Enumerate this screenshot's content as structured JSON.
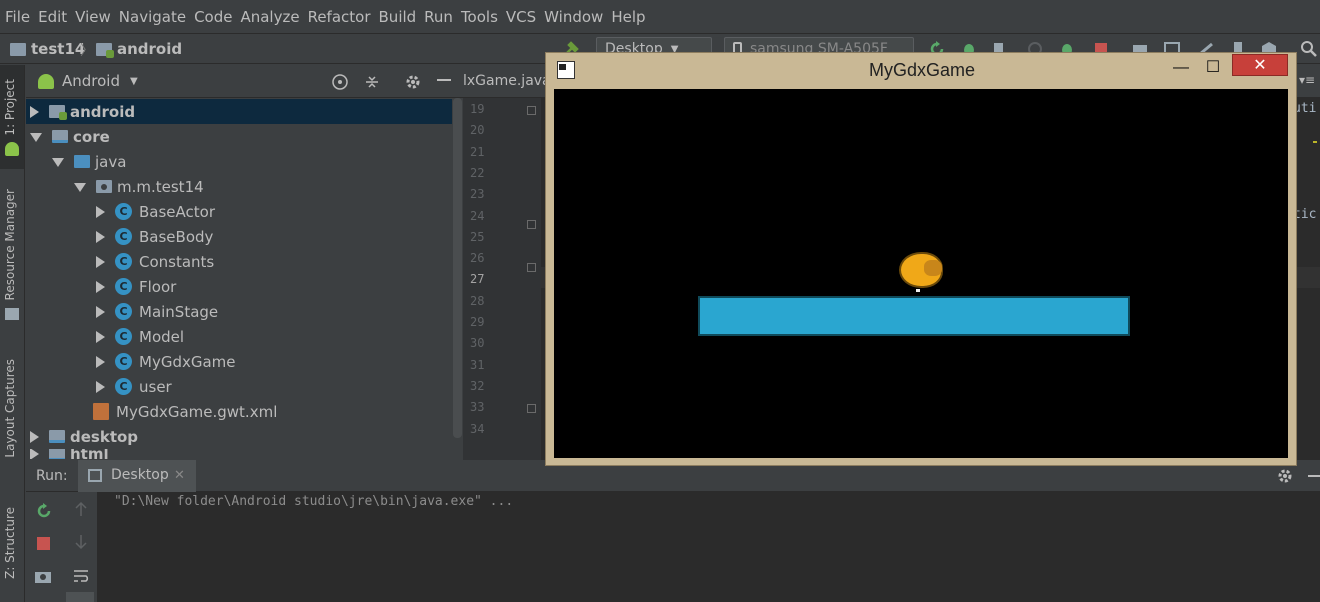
{
  "menu": [
    "File",
    "Edit",
    "View",
    "Navigate",
    "Code",
    "Analyze",
    "Refactor",
    "Build",
    "Run",
    "Tools",
    "VCS",
    "Window",
    "Help"
  ],
  "breadcrumb": {
    "project": "test14",
    "module": "android"
  },
  "toolbar": {
    "run_config": "Desktop",
    "device": "samsung SM-A505F"
  },
  "side_tabs": {
    "project": "1: Project",
    "resource_manager": "Resource Manager",
    "layout_captures": "Layout Captures",
    "structure": "Z: Structure"
  },
  "project_panel": {
    "view_mode": "Android",
    "tree": [
      {
        "label": "android",
        "icon": "android-folder-icon",
        "level": 0,
        "expanded": false,
        "selected": true
      },
      {
        "label": "core",
        "icon": "module-folder-icon",
        "level": 0,
        "expanded": true
      },
      {
        "label": "java",
        "icon": "source-folder-icon",
        "level": 1,
        "expanded": true
      },
      {
        "label": "m.m.test14",
        "icon": "package-icon",
        "level": 2,
        "expanded": true
      },
      {
        "label": "BaseActor",
        "icon": "class-icon",
        "level": 3,
        "expanded": false
      },
      {
        "label": "BaseBody",
        "icon": "class-icon",
        "level": 3,
        "expanded": false
      },
      {
        "label": "Constants",
        "icon": "class-icon",
        "level": 3,
        "expanded": false
      },
      {
        "label": "Floor",
        "icon": "class-icon",
        "level": 3,
        "expanded": false
      },
      {
        "label": "MainStage",
        "icon": "class-icon",
        "level": 3,
        "expanded": false
      },
      {
        "label": "Model",
        "icon": "class-icon",
        "level": 3,
        "expanded": false
      },
      {
        "label": "MyGdxGame",
        "icon": "class-icon",
        "level": 3,
        "expanded": false
      },
      {
        "label": "user",
        "icon": "class-icon",
        "level": 3,
        "expanded": false
      },
      {
        "label": "MyGdxGame.gwt.xml",
        "icon": "xml-file-icon",
        "level": 2
      },
      {
        "label": "desktop",
        "icon": "module-folder-icon",
        "level": 0,
        "expanded": false
      },
      {
        "label": "html",
        "icon": "module-folder-icon",
        "level": 0,
        "expanded": false
      }
    ]
  },
  "editor": {
    "tab": "lxGame.java",
    "line_numbers": [
      "19",
      "20",
      "21",
      "22",
      "23",
      "24",
      "25",
      "26",
      "27",
      "28",
      "29",
      "30",
      "31",
      "32",
      "33",
      "34"
    ],
    "right_fragments": [
      "uti",
      "tic"
    ]
  },
  "run_panel": {
    "label": "Run:",
    "tab": "Desktop",
    "console_line": "\"D:\\New folder\\Android studio\\jre\\bin\\java.exe\" ..."
  },
  "game_window": {
    "title": "MyGdxGame",
    "minimize": "—",
    "maximize": "☐",
    "close": "✕"
  },
  "colors": {
    "ide_bg": "#3c3f41",
    "editor_bg": "#2b2b2b",
    "selection": "#0d293e",
    "class_icon": "#3592c4",
    "game_frame": "#c9b895",
    "close_button": "#c7403a",
    "platform": "#2aa6d0",
    "sheep": "#f0a818"
  }
}
